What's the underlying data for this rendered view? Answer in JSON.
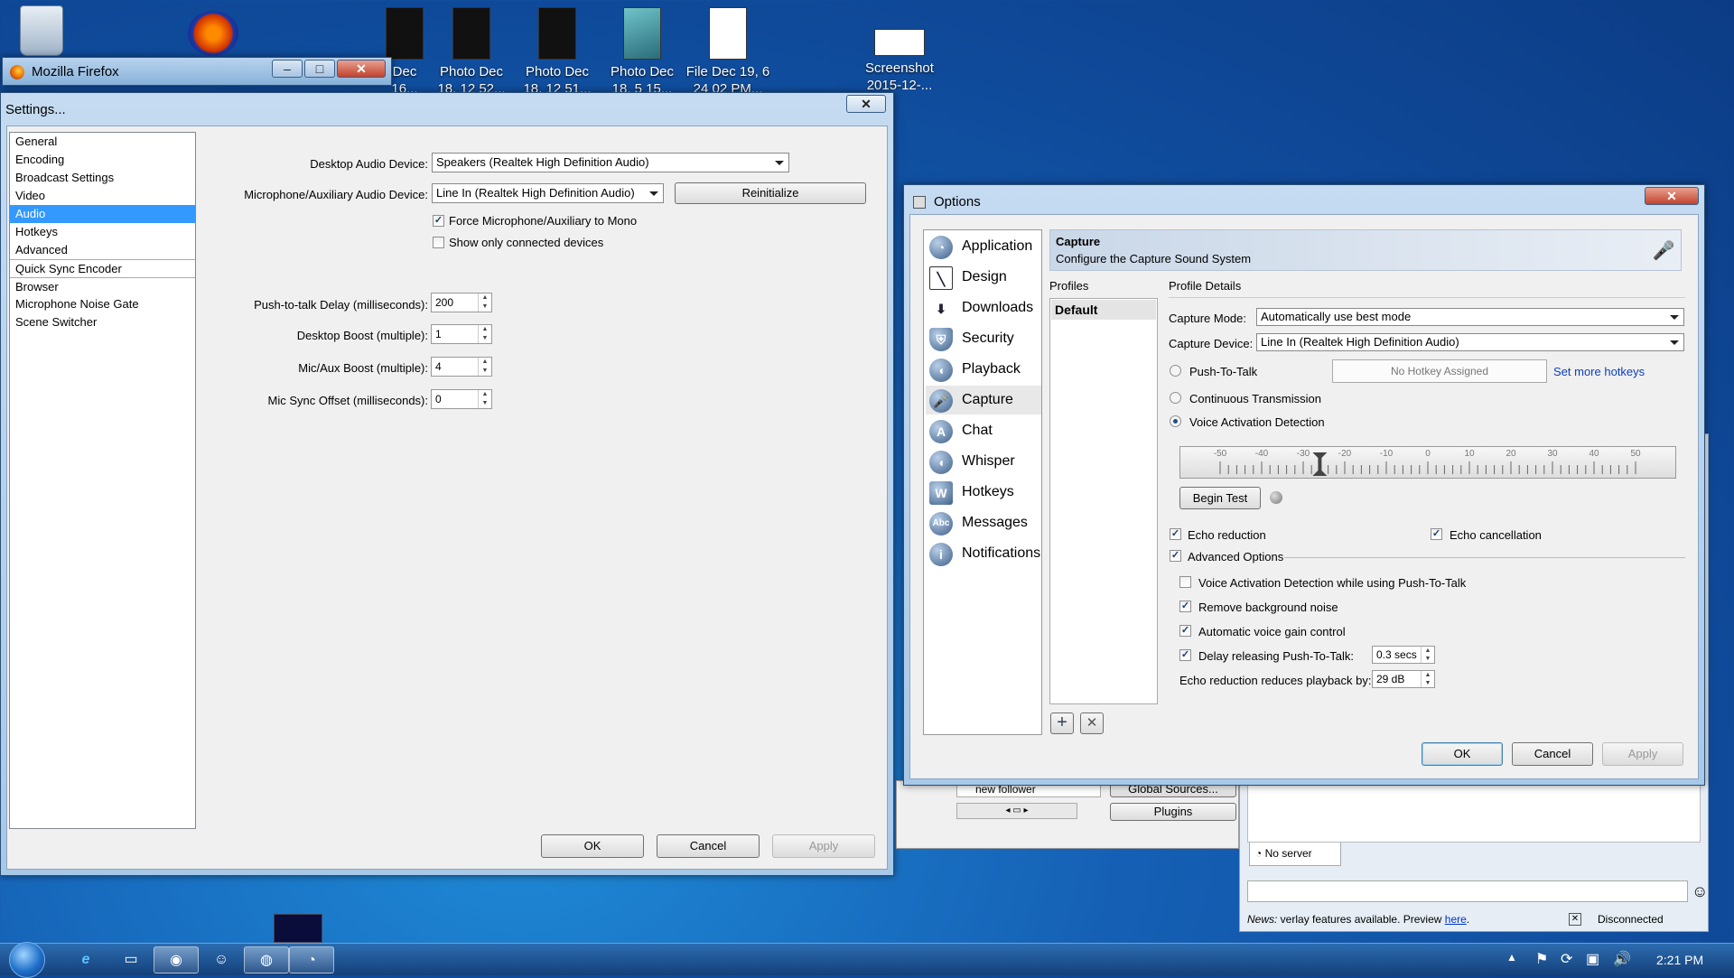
{
  "desktop": {
    "icons": [
      {
        "line1": "Dec",
        "line2": "16..."
      },
      {
        "line1": "Photo Dec",
        "line2": "18, 12 52..."
      },
      {
        "line1": "Photo Dec",
        "line2": "18, 12 51..."
      },
      {
        "line1": "Photo Dec",
        "line2": "18, 5 15..."
      },
      {
        "line1": "File Dec 19, 6",
        "line2": "24 02 PM..."
      },
      {
        "line1": "Screenshot",
        "line2": "2015-12-..."
      }
    ]
  },
  "firefox": {
    "title": "Mozilla Firefox"
  },
  "obs": {
    "title": "Settings...",
    "nav": [
      "General",
      "Encoding",
      "Broadcast Settings",
      "Video",
      "Audio",
      "Hotkeys",
      "Advanced",
      "Quick Sync Encoder",
      "Browser",
      "Microphone Noise Gate",
      "Scene Switcher"
    ],
    "desktop_device_label": "Desktop Audio Device:",
    "desktop_device_value": "Speakers (Realtek High Definition Audio)",
    "mic_device_label": "Microphone/Auxiliary Audio Device:",
    "mic_device_value": "Line In (Realtek High Definition Audio)",
    "reinitialize": "Reinitialize",
    "force_mono": "Force Microphone/Auxiliary to Mono",
    "show_connected": "Show only connected devices",
    "ptt_delay_label": "Push-to-talk Delay (milliseconds):",
    "ptt_delay_value": "200",
    "desktop_boost_label": "Desktop Boost (multiple):",
    "desktop_boost_value": "1",
    "mic_boost_label": "Mic/Aux Boost (multiple):",
    "mic_boost_value": "4",
    "mic_sync_label": "Mic Sync Offset (milliseconds):",
    "mic_sync_value": "0",
    "ok": "OK",
    "cancel": "Cancel",
    "apply": "Apply"
  },
  "options": {
    "title": "Options",
    "nav": [
      "Application",
      "Design",
      "Downloads",
      "Security",
      "Playback",
      "Capture",
      "Chat",
      "Whisper",
      "Hotkeys",
      "Messages",
      "Notifications"
    ],
    "header_title": "Capture",
    "header_sub": "Configure the Capture Sound System",
    "profiles_label": "Profiles",
    "profile_default": "Default",
    "profile_details": "Profile Details",
    "capture_mode_label": "Capture Mode:",
    "capture_mode_value": "Automatically use best mode",
    "capture_device_label": "Capture Device:",
    "capture_device_value": "Line In (Realtek High Definition Audio)",
    "ptt": "Push-To-Talk",
    "no_hotkey": "No Hotkey Assigned",
    "set_more_hotkeys": "Set more hotkeys",
    "continuous": "Continuous Transmission",
    "vad": "Voice Activation Detection",
    "scale": [
      "-50",
      "-40",
      "-30",
      "-20",
      "-10",
      "0",
      "10",
      "20",
      "30",
      "40",
      "50"
    ],
    "vad_threshold": -26,
    "begin_test": "Begin Test",
    "echo_reduction": "Echo reduction",
    "echo_cancellation": "Echo cancellation",
    "advanced_options": "Advanced Options",
    "vad_while_ptt": "Voice Activation Detection while using Push-To-Talk",
    "remove_noise": "Remove background noise",
    "auto_gain": "Automatic voice gain control",
    "delay_ptt": "Delay releasing Push-To-Talk:",
    "delay_ptt_value": "0.3 secs",
    "echo_playback_label": "Echo reduction reduces playback by:",
    "echo_playback_value": "29 dB",
    "ok": "OK",
    "cancel": "Cancel",
    "apply": "Apply"
  },
  "background_apps": {
    "new_follower": "new follower",
    "global_sources": "Global Sources...",
    "plugins": "Plugins",
    "no_server": "No server",
    "news_prefix": "News:",
    "news_text": " verlay features available. Preview ",
    "news_link": "here",
    "disconnected": "Disconnected"
  },
  "taskbar": {
    "time": "2:21 PM"
  }
}
